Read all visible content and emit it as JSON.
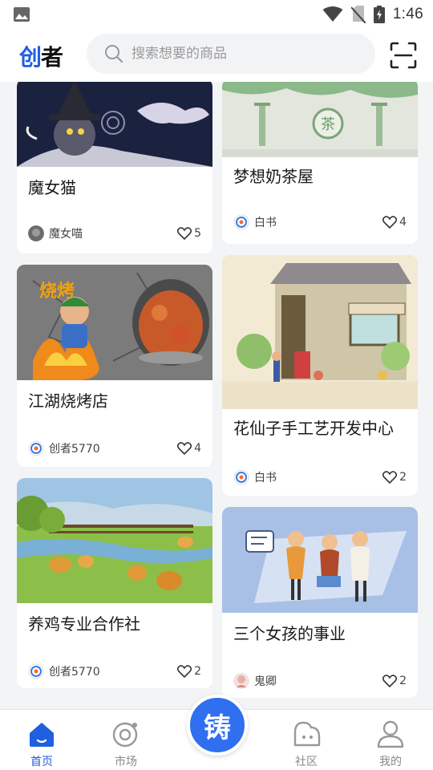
{
  "status_bar": {
    "time": "1:46"
  },
  "header": {
    "logo_text_a": "创",
    "logo_text_b": "者",
    "search_placeholder": "搜索想要的商品"
  },
  "feed": {
    "cards": [
      {
        "title": "魔女猫",
        "author": "魔女喵",
        "likes": "5",
        "image": "witch-cat-illustration"
      },
      {
        "title": "梦想奶茶屋",
        "author": "白书",
        "likes": "4",
        "image": "milk-tea-shop-illustration"
      },
      {
        "title": "江湖烧烤店",
        "author": "创者5770",
        "likes": "4",
        "image": "bbq-illustration"
      },
      {
        "title": "花仙子手工艺开发中心",
        "author": "白书",
        "likes": "2",
        "image": "flower-shop-illustration"
      },
      {
        "title": "养鸡专业合作社",
        "author": "创者5770",
        "likes": "2",
        "image": "chicken-farm-illustration"
      },
      {
        "title": "三个女孩的事业",
        "author": "鬼卿",
        "likes": "2",
        "image": "three-girls-illustration"
      }
    ]
  },
  "bottom_nav": {
    "items": [
      {
        "label": "首页",
        "icon": "home-icon",
        "active": true
      },
      {
        "label": "市场",
        "icon": "market-icon",
        "active": false
      },
      {
        "label": "社区",
        "icon": "community-icon",
        "active": false
      },
      {
        "label": "我的",
        "icon": "profile-icon",
        "active": false
      }
    ],
    "center_button_label": "铸"
  },
  "colors": {
    "accent": "#1f5fe0",
    "fab": "#2f6ff0",
    "background": "#f3f4f6"
  }
}
